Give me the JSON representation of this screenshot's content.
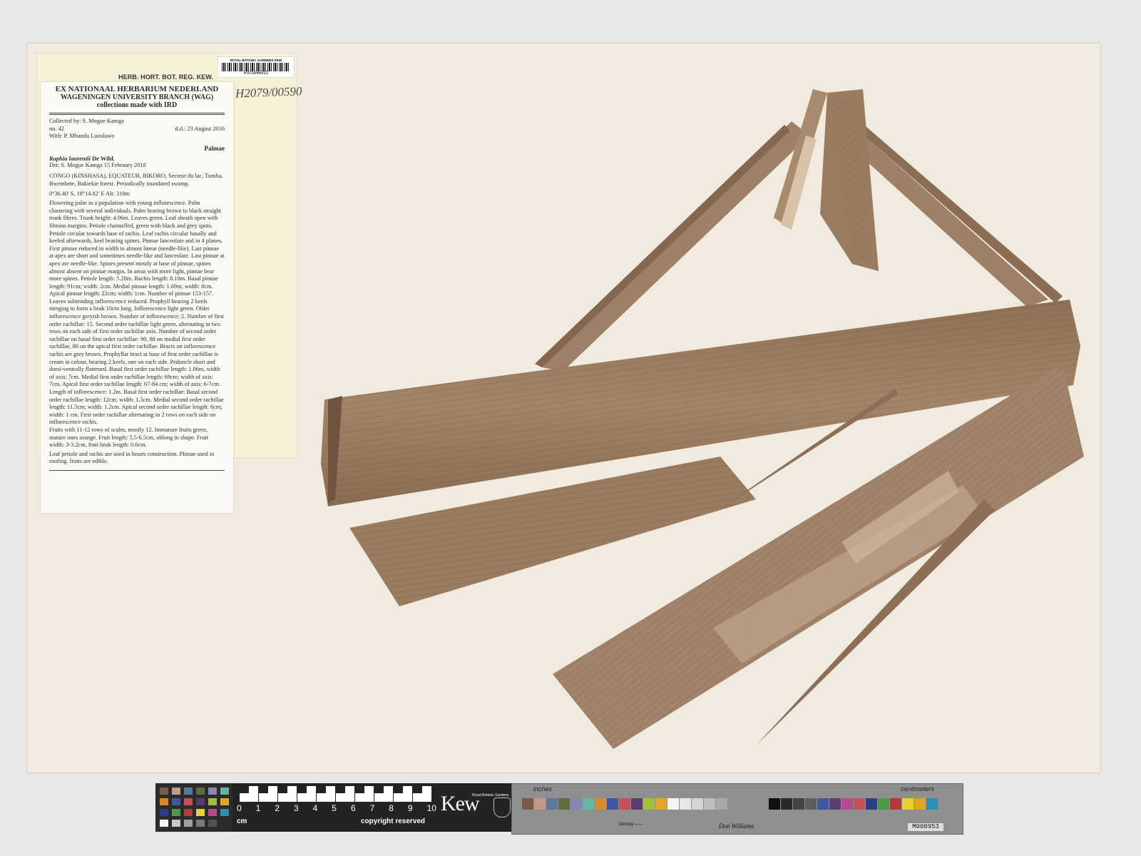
{
  "label_header": "HERB. HORT. BOT. REG. KEW.",
  "barcode": {
    "institution": "ROYAL BOTANIC GARDENS KEW",
    "number": "K001666913"
  },
  "handwritten_number": "H2079/00590",
  "label": {
    "institution_line1": "EX NATIONAAL HERBARIUM NEDERLAND",
    "institution_line2": "WAGENINGEN UNIVERSITY BRANCH (WAG)",
    "institution_line3": "collections made with IRD",
    "collected_by": "Collected by: S. Mogue Kamga",
    "number": "no. 42",
    "date": "d.d.: 23 August 2016",
    "with": "With: P. Mbandu Luzolawo",
    "family": "Palmae",
    "taxon_name": "Raphia laurentii",
    "taxon_author": "De Wild.",
    "determination": "Det: S. Mogue Kamga   15 February 2018",
    "locality": "CONGO (KINSHASA), EQUATEUR, BIKORO, Secteur du lac, Tumba, Bwembete, Bakiekie forest.  Periodically inundated swamp.",
    "coordinates": "0°36.40' S,  18°14.82' E Alt: 318m",
    "description1": "Flowering palm in a population with young inflorescence. Palm clustering with several individuals. Palm bearing brown to black straight trunk fibres.  Trunk height: 4.96m. Leaves green. Leaf sheath open with fibrous margins. Petiole channelled, green with black and grey spots. Petiole circular towards base of rachis. Leaf rachis circular basally and keeled afterwards, keel bearing spines. Pinnae lanceolate and in 4 planes. First pinnae reduced in width to almost linear (needle-like). Last pinnae at apex are short and sometimes needle-like and lanceolate. Last pinnae at apex are needle-like. Spines present mostly at base of pinnae, spines almost absent on pinnae margin. In areas with more light, pinnae bear more spines. Petiole length: 5.20m. Rachis length: 8.10m. Basal pinnae length: 91cm; width: 2cm. Medial pinnae length: 1.69m; width: 8cm. Apical pinnae length: 22cm; width: 1cm. Number of pinnae 153-157.",
    "description2": "Leaves subtending inflorescence reduced. Prophyll bearing 2 keels merging to form a beak 10cm long. Inflorescence light green. Older inflorescence greyish brown. Number of inflorescence: 2. Number of first order rachillae: 15. Second order rachillae light green, alternating in two rows on each side of first order rachillae axis. Number of second order rachillae on basal first order rachillae: 90, 88 on medial first order rachillae, 80 on the apical first order rachillae. Bracts on inflorescence rachis are grey brown. Prophyllar bract at base of first order rachillae is cream in colour, bearing 2 keels, one on each side. Peduncle short and dorsi-ventrally flattened. Basal first order rachillae length: 1.06m, width of axis: 7cm. Medial first order rachillae length: 69cm; width of axis: 7cm. Apical first order rachillae length: 67-84 cm; width of axis: 6-7cm. Length of inflorescence: 1.2m. Basal first order rachillae: Basal second order rachillae length: 12cm; width: 1.5cm. Medial second order rachillae length: 11.5cm; width: 1.2cm. Apical second order rachillae length: 6cm; width: 1 cm. First order rachillae alternating in 2 rows on each side on inflorescence rachis.",
    "description3": "Fruits with 11-12 rows of scales, mostly 12. Immature fruits green, mature ones orange. Fruit length: 5.5-6.5cm, oblong in shape. Fruit width: 3-3.2cm, fruit beak length: 0.6cm.",
    "uses": "Leaf petiole and rachis are used in houes construction. PInnae used in roofing. fruits are edible."
  },
  "ruler": {
    "numbers": [
      "0",
      "1",
      "2",
      "3",
      "4",
      "5",
      "6",
      "7",
      "8",
      "9",
      "10"
    ],
    "unit": "cm",
    "copyright": "copyright reserved"
  },
  "kew": {
    "logo": "Kew",
    "small_text": "Royal Botanic Gardens"
  },
  "color_target": {
    "inches_label": "inches",
    "centimeters_label": "centimeters",
    "density_label": "Density ——",
    "signature": "Don Williams",
    "code": "M000953"
  },
  "colors": {
    "sheet": "#f1ebdf",
    "leaf_main": "#9c7d61",
    "leaf_dark": "#7f634b",
    "leaf_light": "#c4ab92"
  }
}
